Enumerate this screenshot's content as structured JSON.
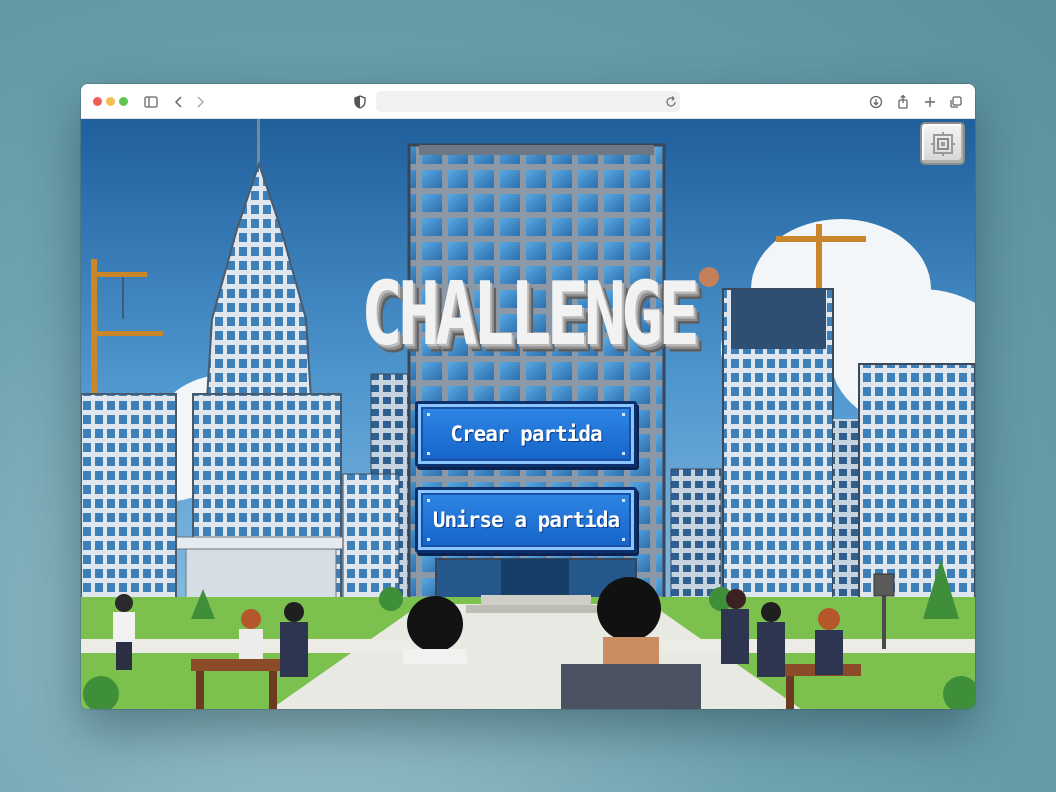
{
  "browser": {
    "traffic_lights": {
      "close": "#ec5f57",
      "minimize": "#f4bd4f",
      "maximize": "#61c554"
    },
    "toolbar_icons": [
      "sidebar-icon",
      "back-icon",
      "forward-icon",
      "shield-icon",
      "reload-icon",
      "download-icon",
      "share-icon",
      "new-tab-icon",
      "tabs-overview-icon"
    ],
    "url": ""
  },
  "game": {
    "title": "CHALLENGE",
    "settings_icon": "gear-icon",
    "menu": [
      {
        "id": "create",
        "label": "Crear partida"
      },
      {
        "id": "join",
        "label": "Unirse a partida"
      }
    ],
    "colors": {
      "button": "#1e74db",
      "button_border": "#0c2f6d",
      "sky": "#3d8ac8"
    }
  }
}
